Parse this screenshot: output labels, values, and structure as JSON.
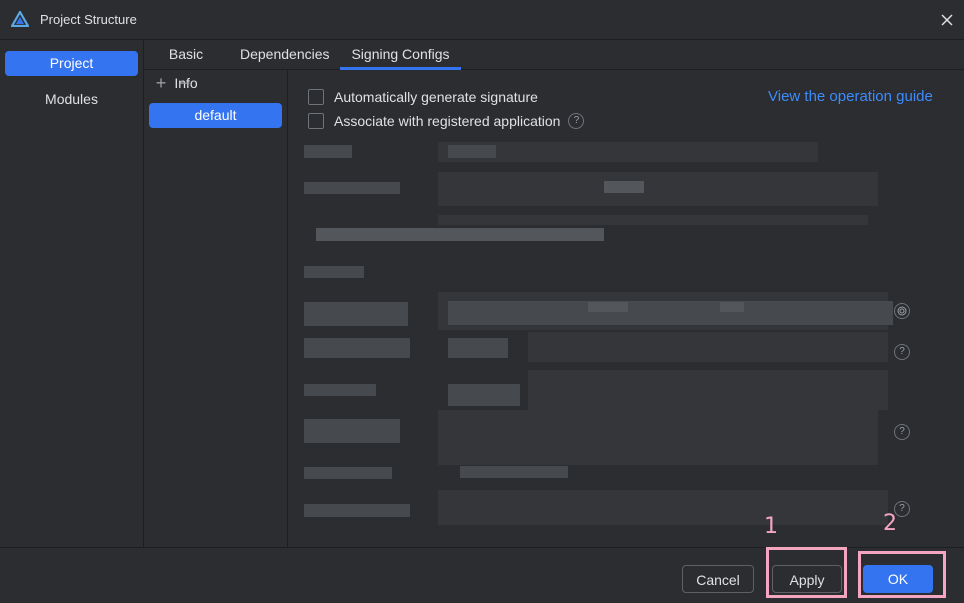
{
  "window": {
    "title": "Project Structure"
  },
  "sidebar": {
    "items": [
      {
        "label": "Project",
        "active": true
      },
      {
        "label": "Modules",
        "active": false
      }
    ]
  },
  "tabs": [
    {
      "label": "Basic Info",
      "active": false
    },
    {
      "label": "Dependencies",
      "active": false
    },
    {
      "label": "Signing Configs",
      "active": true
    }
  ],
  "configs": {
    "add_symbol": "+",
    "remove_symbol": "−",
    "items": [
      "default"
    ]
  },
  "signing": {
    "auto_generate_label": "Automatically generate signature",
    "auto_generate_checked": false,
    "associate_label": "Associate with registered application",
    "associate_checked": false,
    "help_symbol": "?",
    "guide_link": "View the operation guide"
  },
  "footer": {
    "cancel_label": "Cancel",
    "apply_label": "Apply",
    "ok_label": "OK"
  },
  "annotations": {
    "apply_number": "1",
    "ok_number": "2"
  },
  "colors": {
    "accent": "#3574f0",
    "link": "#3d8bfd",
    "annotation": "#f4a6c1",
    "background": "#2b2d30"
  },
  "icons": {
    "logo": "app-logo-icon",
    "close": "close-icon",
    "help": "help-icon",
    "fingerprint": "fingerprint-icon"
  }
}
